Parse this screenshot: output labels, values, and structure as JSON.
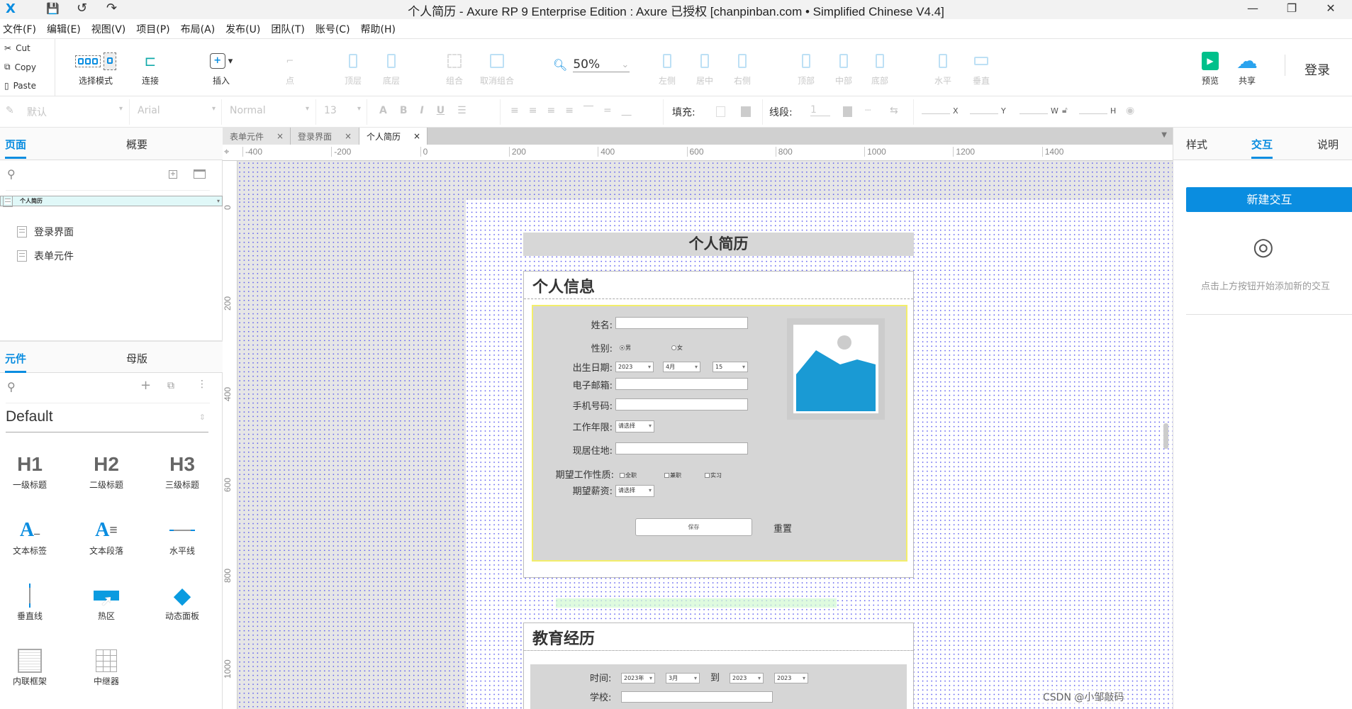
{
  "window": {
    "title": "个人简历 - Axure RP 9 Enterprise Edition : Axure 已授权    [chanpinban.com • Simplified Chinese V4.4]",
    "minimize": "—",
    "restore": "❐",
    "close": "✕"
  },
  "menu": [
    "文件(F)",
    "编辑(E)",
    "视图(V)",
    "项目(P)",
    "布局(A)",
    "发布(U)",
    "团队(T)",
    "账号(C)",
    "帮助(H)"
  ],
  "clipboard": {
    "cut": "Cut",
    "copy": "Copy",
    "paste": "Paste"
  },
  "toolbar": {
    "select_mode": "选择模式",
    "connect": "连接",
    "insert": "插入",
    "point": "点",
    "front": "顶层",
    "back": "底层",
    "group": "组合",
    "ungroup": "取消组合",
    "zoom": "50%",
    "left": "左侧",
    "center": "居中",
    "right": "右侧",
    "top": "顶部",
    "middle": "中部",
    "bottom": "底部",
    "horizontal": "水平",
    "vertical": "垂直",
    "preview": "预览",
    "share": "共享",
    "login": "登录"
  },
  "format": {
    "style": "默认",
    "font": "Arial",
    "weight": "Normal",
    "size": "13",
    "fill_label": "填充:",
    "line_label": "线段:",
    "line_width": "1",
    "x": "X",
    "y": "Y",
    "w": "W",
    "h": "H"
  },
  "left_panel": {
    "tabs": [
      "页面",
      "概要"
    ],
    "pages": [
      "个人简历",
      "登录界面",
      "表单元件"
    ],
    "lib_tabs": [
      "元件",
      "母版"
    ],
    "library": "Default",
    "widgets": [
      {
        "icon": "H1",
        "label": "一级标题"
      },
      {
        "icon": "H2",
        "label": "二级标题"
      },
      {
        "icon": "H3",
        "label": "三级标题"
      },
      {
        "label": "文本标签"
      },
      {
        "label": "文本段落"
      },
      {
        "label": "水平线"
      },
      {
        "label": "垂直线"
      },
      {
        "label": "热区"
      },
      {
        "label": "动态面板"
      },
      {
        "label": "内联框架"
      },
      {
        "label": "中继器"
      }
    ]
  },
  "doc_tabs": [
    "表单元件",
    "登录界面",
    "个人简历"
  ],
  "ruler": {
    "h": [
      "-400",
      "-200",
      "0",
      "200",
      "400",
      "600",
      "800",
      "1000",
      "1200",
      "1400"
    ],
    "v": [
      "0",
      "200",
      "400",
      "600",
      "800",
      "1000"
    ]
  },
  "page": {
    "title": "个人简历",
    "personal": {
      "heading": "个人信息",
      "name_label": "姓名:",
      "gender_label": "性别:",
      "male": "男",
      "female": "女",
      "gender_selected": "男",
      "birth_label": "出生日期:",
      "birth_year": "2023",
      "birth_month": "4月",
      "birth_day": "15",
      "email_label": "电子邮箱:",
      "phone_label": "手机号码:",
      "years_label": "工作年限:",
      "years_value": "请选择",
      "address_label": "现居住地:",
      "jobtype_label": "期望工作性质:",
      "jobtypes": [
        "全职",
        "兼职",
        "实习"
      ],
      "salary_label": "期望薪资:",
      "salary_value": "请选择",
      "save": "保存",
      "reset": "重置"
    },
    "education": {
      "heading": "教育经历",
      "time_label": "时间:",
      "from_year": "2023年",
      "from_month": "3月",
      "to": "到",
      "to_year": "2023",
      "to_month": "2023",
      "school_label": "学校:"
    }
  },
  "right_panel": {
    "tabs": [
      "样式",
      "交互",
      "说明"
    ],
    "new_interaction": "新建交互",
    "hint": "点击上方按钮开始添加新的交互"
  },
  "watermark": "CSDN @小邹敲码",
  "colors": {
    "accent": "#0a8de0",
    "image_blue": "#1a9ad4",
    "preview_green": "#00c08b"
  }
}
